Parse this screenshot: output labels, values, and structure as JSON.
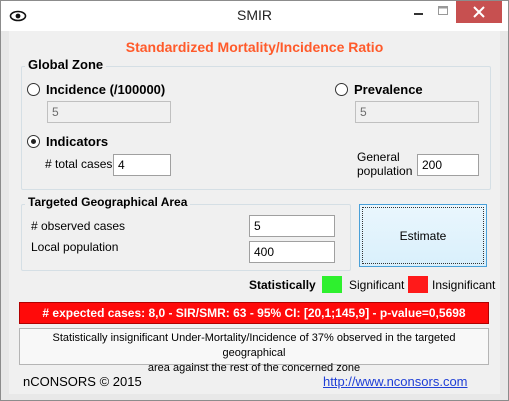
{
  "window": {
    "title": "SMIR"
  },
  "icons": {
    "app": "eye-icon",
    "minimize": "minimize-icon",
    "maximize": "maximize-icon",
    "close": "close-icon"
  },
  "colors": {
    "heading": "#ff5a2a",
    "significant": "#2ef02e",
    "insignificant": "#ff1a1a",
    "result_bar": "#ff0a0a",
    "link": "#1f3fd6"
  },
  "heading": "Standardized Mortality/Incidence Ratio",
  "global_zone": {
    "label": "Global Zone",
    "incidence": {
      "label": "Incidence (/100000)",
      "selected": false,
      "value": "5"
    },
    "prevalence": {
      "label": "Prevalence",
      "selected": false,
      "value": "5"
    },
    "indicators": {
      "label": "Indicators",
      "selected": true
    },
    "total_cases": {
      "label": "# total cases",
      "value": "4"
    },
    "general_population": {
      "label_line1": "General",
      "label_line2": "population",
      "value": "200"
    }
  },
  "targeted_area": {
    "label": "Targeted Geographical Area",
    "observed_cases": {
      "label": "# observed cases",
      "value": "5"
    },
    "local_population": {
      "label": "Local population",
      "value": "400"
    }
  },
  "estimate_button": "Estimate",
  "legend": {
    "title": "Statistically",
    "significant": "Significant",
    "insignificant": "Insignificant"
  },
  "result": "# expected cases: 8,0 - SIR/SMR: 63 - 95% CI: [20,1;145,9] - p-value=0,5698",
  "summary": {
    "line1": "Statistically insignificant Under-Mortality/Incidence of 37% observed in the targeted geographical",
    "line2": "area against the rest of the concerned zone"
  },
  "footer": {
    "copyright": "nCONSORS © 2015",
    "link": "http://www.nconsors.com"
  }
}
